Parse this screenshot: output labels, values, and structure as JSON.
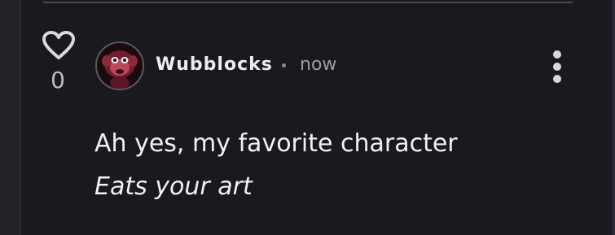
{
  "comment": {
    "likes": {
      "icon": "heart-outline-icon",
      "count": "0"
    },
    "author": {
      "name": "Wubblocks",
      "avatar_icon": "monkey-avatar-icon"
    },
    "separator": "•",
    "timestamp": "now",
    "more_menu_icon": "vertical-ellipsis-icon",
    "body": {
      "line1": "Ah yes, my favorite character",
      "line2": "Eats your art"
    }
  },
  "colors": {
    "background": "#19191f",
    "text": "#f1f1f5",
    "muted": "#9e9ea8",
    "icon": "#d8d8df"
  }
}
